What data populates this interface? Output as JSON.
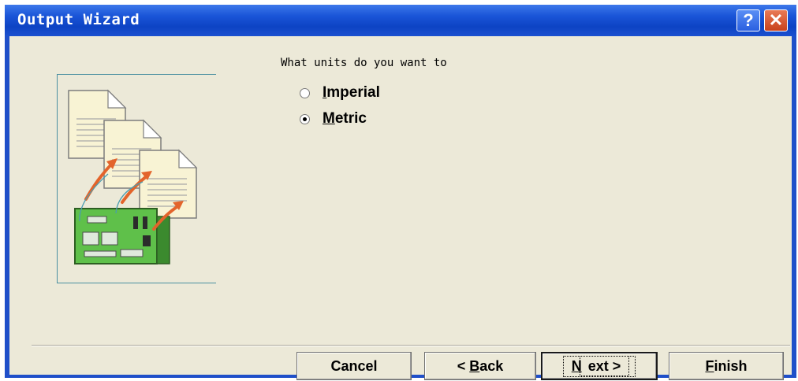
{
  "window": {
    "title": "Output Wizard",
    "help_glyph": "?",
    "close_glyph": "✕"
  },
  "content": {
    "prompt": "What units do you want to",
    "options": [
      {
        "access_key": "I",
        "rest": "mperial",
        "selected": false
      },
      {
        "access_key": "M",
        "rest": "etric",
        "selected": true
      }
    ]
  },
  "buttons": {
    "cancel": {
      "label": "Cancel"
    },
    "back": {
      "prefix": "< ",
      "access_key": "B",
      "rest": "ack"
    },
    "next": {
      "access_key": "N",
      "rest": "ext >"
    },
    "finish": {
      "access_key": "F",
      "rest": "inish"
    }
  },
  "icons": {
    "illustration": "documents-to-circuit-board-icon"
  },
  "colors": {
    "titlebar": "#1a55d8",
    "client_bg": "#ece9d8",
    "close_button": "#c8421c",
    "arrow": "#e3642b"
  }
}
